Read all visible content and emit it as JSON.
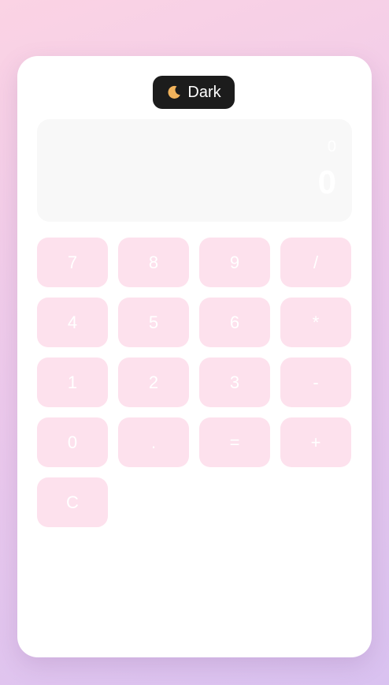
{
  "theme_toggle": {
    "icon": "moon-icon",
    "label": "Dark"
  },
  "display": {
    "expression": "0",
    "result": "0"
  },
  "keypad": {
    "keys": [
      {
        "id": "7",
        "label": "7"
      },
      {
        "id": "8",
        "label": "8"
      },
      {
        "id": "9",
        "label": "9"
      },
      {
        "id": "divide",
        "label": "/"
      },
      {
        "id": "4",
        "label": "4"
      },
      {
        "id": "5",
        "label": "5"
      },
      {
        "id": "6",
        "label": "6"
      },
      {
        "id": "multiply",
        "label": "*"
      },
      {
        "id": "1",
        "label": "1"
      },
      {
        "id": "2",
        "label": "2"
      },
      {
        "id": "3",
        "label": "3"
      },
      {
        "id": "subtract",
        "label": "-"
      },
      {
        "id": "0",
        "label": "0"
      },
      {
        "id": "decimal",
        "label": "."
      },
      {
        "id": "equals",
        "label": "="
      },
      {
        "id": "add",
        "label": "+"
      },
      {
        "id": "clear",
        "label": "C"
      }
    ]
  },
  "colors": {
    "key_background": "#fde1ed",
    "toggle_background": "#1c1c1c",
    "display_background": "#f8f8f8"
  }
}
